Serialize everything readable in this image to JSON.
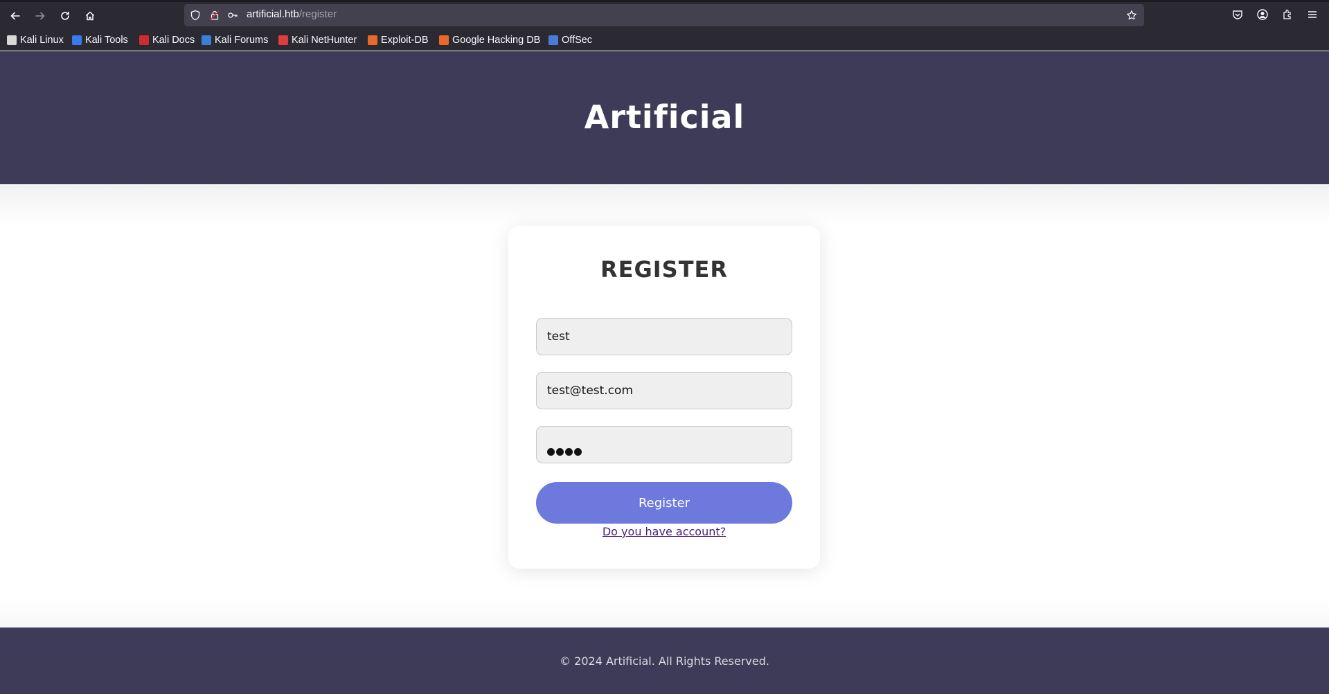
{
  "browser": {
    "url_host": "artificial.htb",
    "url_path": "/register",
    "bookmarks": [
      {
        "label": "Kali Linux",
        "icon": "kali-dragon-icon",
        "color": "#d8d8d8"
      },
      {
        "label": "Kali Tools",
        "icon": "kali-tools-icon",
        "color": "#367bf0"
      },
      {
        "label": "Kali Docs",
        "icon": "kali-docs-icon",
        "color": "#d12c2c"
      },
      {
        "label": "Kali Forums",
        "icon": "kali-forums-icon",
        "color": "#3a7fd8"
      },
      {
        "label": "Kali NetHunter",
        "icon": "kali-nethunter-icon",
        "color": "#e23c3c"
      },
      {
        "label": "Exploit-DB",
        "icon": "exploit-db-icon",
        "color": "#e8692a"
      },
      {
        "label": "Google Hacking DB",
        "icon": "ghdb-icon",
        "color": "#e8692a"
      },
      {
        "label": "OffSec",
        "icon": "offsec-icon",
        "color": "#4b7bd8"
      }
    ]
  },
  "header": {
    "title": "Artificial"
  },
  "form": {
    "title": "REGISTER",
    "username_value": "test",
    "email_value": "test@test.com",
    "password_value": "test",
    "submit_label": "Register",
    "login_link": "Do you have account?"
  },
  "footer": {
    "text": "© 2024 Artificial. All Rights Reserved."
  },
  "colors": {
    "header_bg": "#3e3b58",
    "button": "#6d79dc",
    "link": "#4a1f7a"
  }
}
